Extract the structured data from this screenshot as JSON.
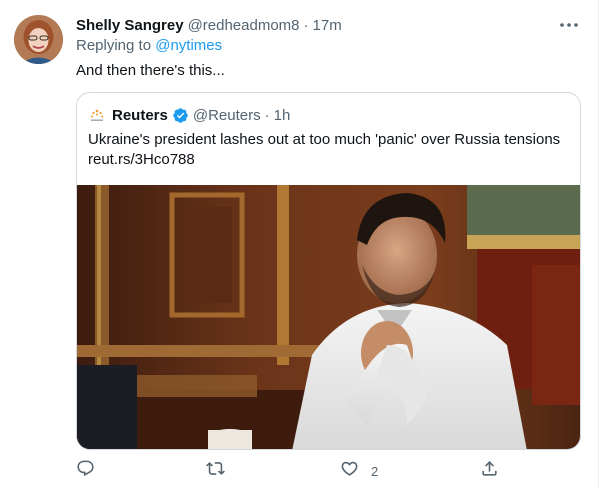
{
  "tweet": {
    "author_name": "Shelly Sangrey",
    "author_handle": "@redheadmom8",
    "separator": "·",
    "time": "17m",
    "replying_prefix": "Replying to",
    "replying_to": "@nytimes",
    "text": "And then there's this..."
  },
  "quoted": {
    "author_name": "Reuters",
    "author_handle": "@Reuters",
    "separator": "·",
    "time": "1h",
    "text_line1": "Ukraine's president lashes out at too much 'panic' over Russia tensions",
    "text_line2": "reut.rs/3Hco788",
    "logo_icon": "reuters-logo",
    "verified_icon": "verified-badge-icon"
  },
  "actions": {
    "reply_icon": "reply-icon",
    "retweet_icon": "retweet-icon",
    "like_icon": "like-icon",
    "like_count": "2",
    "share_icon": "share-icon"
  },
  "colors": {
    "accent": "#1d9bf0",
    "text_primary": "#0f1419",
    "text_secondary": "#536471",
    "border": "#cfd9de"
  }
}
